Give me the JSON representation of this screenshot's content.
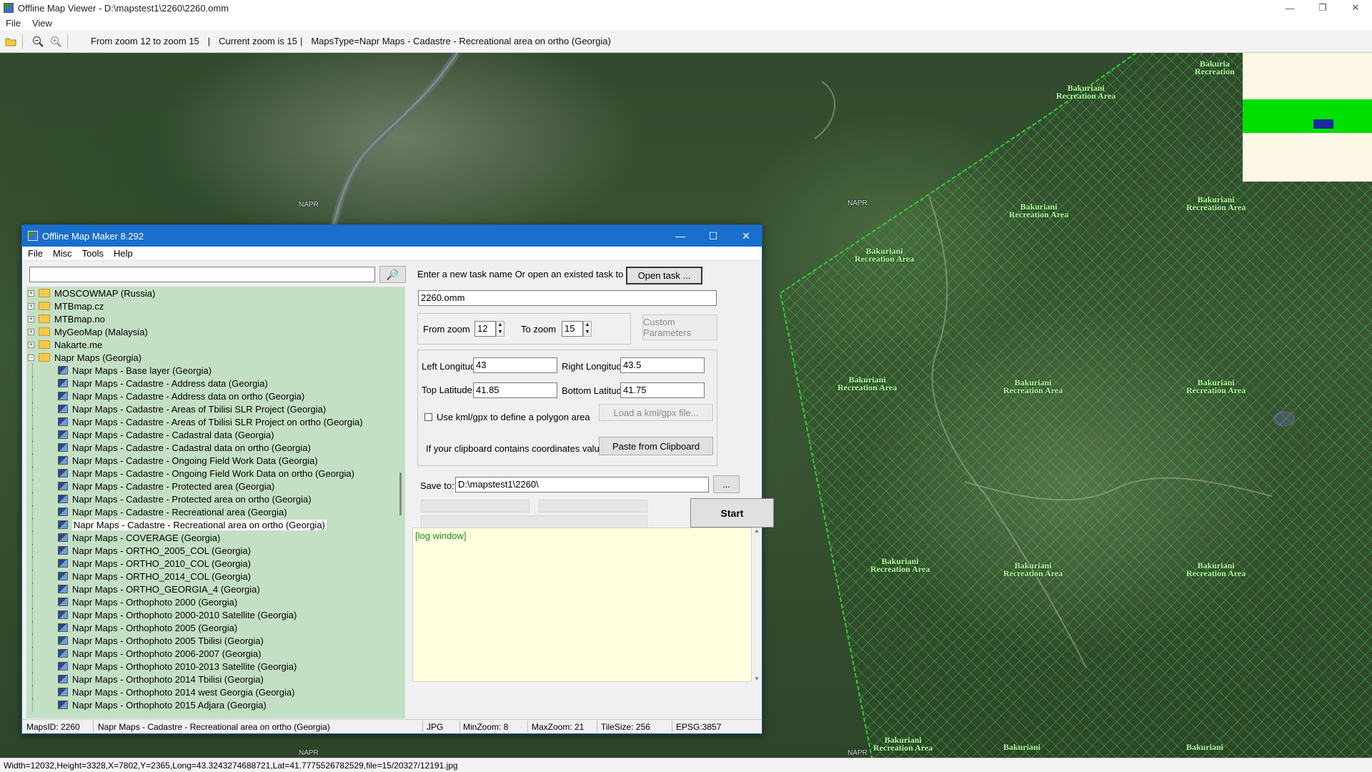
{
  "window": {
    "title": "Offline Map Viewer - D:\\mapstest1\\2260\\2260.omm",
    "min": "—",
    "max": "❐",
    "close": "✕"
  },
  "menu": [
    "File",
    "View"
  ],
  "toolbar": {
    "open_icon": "folder-open-icon",
    "zoom_out_icon": "zoom-out-icon",
    "zoom_in_icon": "zoom-in-icon",
    "zoom_range": "From zoom 12 to zoom 15",
    "sep1": "|",
    "current_zoom": "Current zoom is 15",
    "sep2": "|",
    "maps_type": "MapsType=Napr Maps - Cadastre - Recreational area on ortho (Georgia)"
  },
  "map": {
    "napr_labels": [
      "NAPR",
      "NAPR",
      "NAPR",
      "NAPR"
    ],
    "area_label_line1": "Bakuriani",
    "area_label_line2": "Recreation Area",
    "area_label_partial_line1": "Bakuria",
    "area_label_partial_line2": "Recreation",
    "colors": {
      "hatch": "#3cc83c",
      "minimap_band": "#00e000",
      "minimap_box": "#1a2a9a"
    }
  },
  "status": "Width=12032,Height=3328,X=7802,Y=2365,Long=43.3243274688721,Lat=41.7775526782529,file=15/20327/12191.jpg",
  "dialog": {
    "title": "Offline Map Maker 8.292",
    "min": "—",
    "max": "☐",
    "close": "✕",
    "menu": [
      "File",
      "Misc",
      "Tools",
      "Help"
    ],
    "search_value": "",
    "search_icon": "🔎",
    "tree": {
      "folders": [
        {
          "label": "MOSCOWMAP (Russia)",
          "expander": "+"
        },
        {
          "label": "MTBmap.cz",
          "expander": "+"
        },
        {
          "label": "MTBmap.no",
          "expander": "+"
        },
        {
          "label": "MyGeoMap (Malaysia)",
          "expander": "+"
        },
        {
          "label": "Nakarte.me",
          "expander": "+"
        },
        {
          "label": "Napr Maps (Georgia)",
          "expander": "−"
        }
      ],
      "items": [
        "Napr Maps - Base layer (Georgia)",
        "Napr Maps - Cadastre - Address data (Georgia)",
        "Napr Maps - Cadastre - Address data on ortho (Georgia)",
        "Napr Maps - Cadastre - Areas of Tbilisi SLR Project (Georgia)",
        "Napr Maps - Cadastre - Areas of Tbilisi SLR Project on ortho (Georgia)",
        "Napr Maps - Cadastre - Cadastral data (Georgia)",
        "Napr Maps - Cadastre - Cadastral data on ortho (Georgia)",
        "Napr Maps - Cadastre - Ongoing Field Work Data (Georgia)",
        "Napr Maps - Cadastre - Ongoing Field Work Data on ortho (Georgia)",
        "Napr Maps - Cadastre - Protected area (Georgia)",
        "Napr Maps - Cadastre - Protected area on ortho (Georgia)",
        "Napr Maps - Cadastre - Recreational area (Georgia)",
        "Napr Maps - Cadastre - Recreational area on ortho (Georgia)",
        "Napr Maps - COVERAGE (Georgia)",
        "Napr Maps - ORTHO_2005_COL (Georgia)",
        "Napr Maps - ORTHO_2010_COL (Georgia)",
        "Napr Maps - ORTHO_2014_COL (Georgia)",
        "Napr Maps - ORTHO_GEORGIA_4 (Georgia)",
        "Napr Maps - Orthophoto 2000 (Georgia)",
        "Napr Maps - Orthophoto 2000-2010 Satellite (Georgia)",
        "Napr Maps - Orthophoto 2005 (Georgia)",
        "Napr Maps - Orthophoto 2005 Tbilisi (Georgia)",
        "Napr Maps - Orthophoto 2006-2007 (Georgia)",
        "Napr Maps - Orthophoto 2010-2013 Satellite (Georgia)",
        "Napr Maps - Orthophoto 2014 Tbilisi (Georgia)",
        "Napr Maps - Orthophoto 2014 west Georgia (Georgia)",
        "Napr Maps - Orthophoto 2015 Adjara (Georgia)"
      ],
      "selected_item": "Napr Maps - Cadastre - Recreational area on ortho (Georgia)",
      "tree_bg": "#c4e0c4"
    },
    "form": {
      "task_prompt": "Enter a new task name Or open an existed task to continue:",
      "open_task": "Open task ...",
      "task_name": "2260.omm",
      "from_zoom_label": "From zoom",
      "from_zoom": "12",
      "to_zoom_label": "To zoom",
      "to_zoom": "15",
      "spin_up": "▲",
      "spin_down": "▼",
      "custom_params": "Custom Parameters",
      "left_lon_label": "Left Longitude",
      "left_lon": "43",
      "right_lon_label": "Right Longitude",
      "right_lon": "43.5",
      "top_lat_label": "Top Latitude",
      "top_lat": "41.85",
      "bottom_lat_label": "Bottom Latitude",
      "bottom_lat": "41.75",
      "kml_label": "Use kml/gpx to define a polygon area",
      "load_kml": "Load a kml/gpx file...",
      "clipboard_label": "If your clipboard contains coordinates values:",
      "paste": "Paste from Clipboard",
      "save_to_label": "Save to:",
      "save_to": "D:\\mapstest1\\2260\\",
      "browse": "...",
      "start": "Start",
      "log": "[log window]",
      "log_scroll_up": "▲",
      "log_scroll_down": "▼"
    },
    "status": {
      "maps_id": "MapsID: 2260",
      "maps_name": "Napr Maps - Cadastre - Recreational area on ortho (Georgia)",
      "format": "JPG",
      "min_zoom": "MinZoom: 8",
      "max_zoom": "MaxZoom: 21",
      "tile_size": "TileSize: 256",
      "epsg": "EPSG:3857"
    }
  }
}
